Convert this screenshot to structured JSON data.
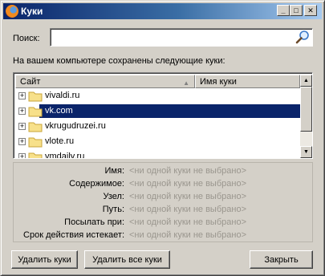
{
  "window": {
    "title": "Куки",
    "min_glyph": "_",
    "max_glyph": "□",
    "close_glyph": "✕"
  },
  "search": {
    "label": "Поиск:",
    "value": "",
    "placeholder": ""
  },
  "info_text": "На вашем компьютере сохранены следующие куки:",
  "tree": {
    "columns": [
      "Сайт",
      "Имя куки"
    ],
    "sort_glyph": "▲",
    "rows": [
      {
        "label": "vivaldi.ru",
        "selected": false
      },
      {
        "label": "vk.com",
        "selected": true
      },
      {
        "label": "vkrugudruzei.ru",
        "selected": false
      },
      {
        "label": "vlote.ru",
        "selected": false
      },
      {
        "label": "vmdaily.ru",
        "selected": false
      }
    ],
    "expander_glyph": "+",
    "scroll_up_glyph": "▲",
    "scroll_down_glyph": "▼"
  },
  "details": {
    "fields": [
      {
        "label": "Имя:",
        "value": "<ни одной куки не выбрано>"
      },
      {
        "label": "Содержимое:",
        "value": "<ни одной куки не выбрано>"
      },
      {
        "label": "Узел:",
        "value": "<ни одной куки не выбрано>"
      },
      {
        "label": "Путь:",
        "value": "<ни одной куки не выбрано>"
      },
      {
        "label": "Посылать при:",
        "value": "<ни одной куки не выбрано>"
      },
      {
        "label": "Срок действия истекает:",
        "value": "<ни одной куки не выбрано>"
      }
    ]
  },
  "buttons": {
    "remove": "Удалить куки",
    "remove_all": "Удалить все куки",
    "close": "Закрыть"
  },
  "colors": {
    "selection": "#0a246a",
    "dialog_face": "#d4d0c8",
    "disabled_text": "#9a968e"
  },
  "icons": {
    "app": "firefox-icon",
    "search": "magnifier-icon",
    "folder": "folder-icon"
  }
}
